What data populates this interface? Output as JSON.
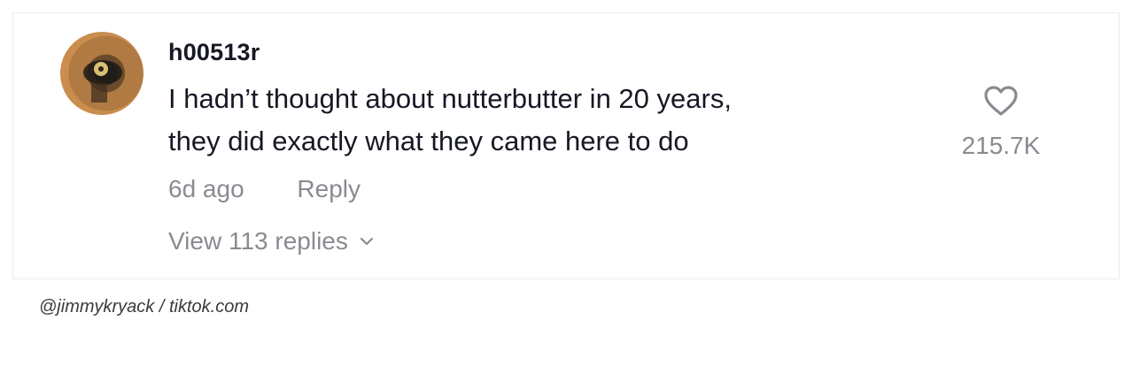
{
  "comment": {
    "username": "h00513r",
    "text_line_1": "I hadn’t thought about nutterbutter in 20 years,",
    "text_line_2": "they did exactly what they came here to do",
    "time": "6d ago",
    "reply_label": "Reply",
    "view_replies_label": "View 113 replies",
    "like_count": "215.7K",
    "icons": {
      "avatar": "avatar",
      "like": "heart-icon",
      "expand": "chevron-down-icon"
    }
  },
  "credit": "@jimmykryack / tiktok.com",
  "colors": {
    "text_primary": "#161823",
    "text_secondary": "#8a8b91",
    "background": "#ffffff"
  }
}
